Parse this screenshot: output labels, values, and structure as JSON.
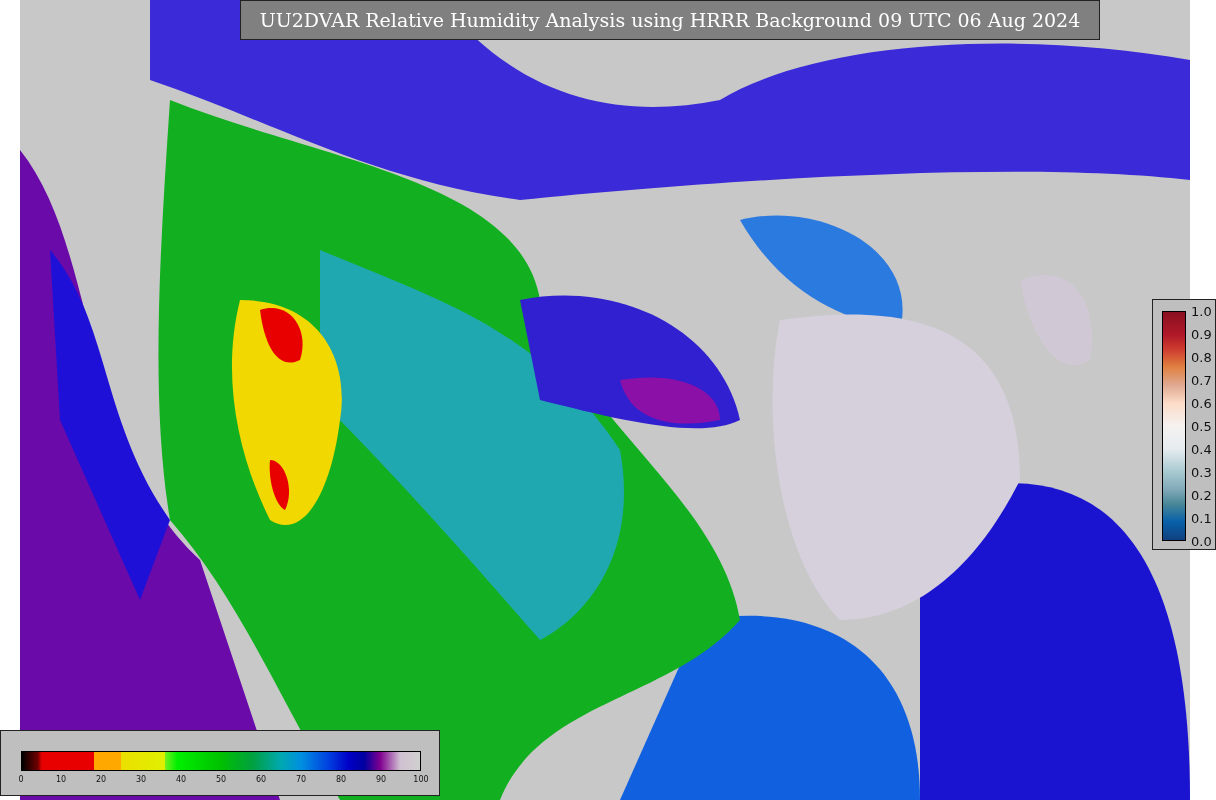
{
  "title": "UU2DVAR Relative Humidity Analysis using HRRR Background 09 UTC 06 Aug 2024",
  "humidity_colorbar": {
    "ticks": [
      "0",
      "10",
      "20",
      "30",
      "40",
      "50",
      "60",
      "70",
      "80",
      "90",
      "100"
    ]
  },
  "observation_colorbar": {
    "ticks": [
      "1.0",
      "0.9",
      "0.8",
      "0.7",
      "0.6",
      "0.5",
      "0.4",
      "0.3",
      "0.2",
      "0.1",
      "0.0"
    ]
  }
}
